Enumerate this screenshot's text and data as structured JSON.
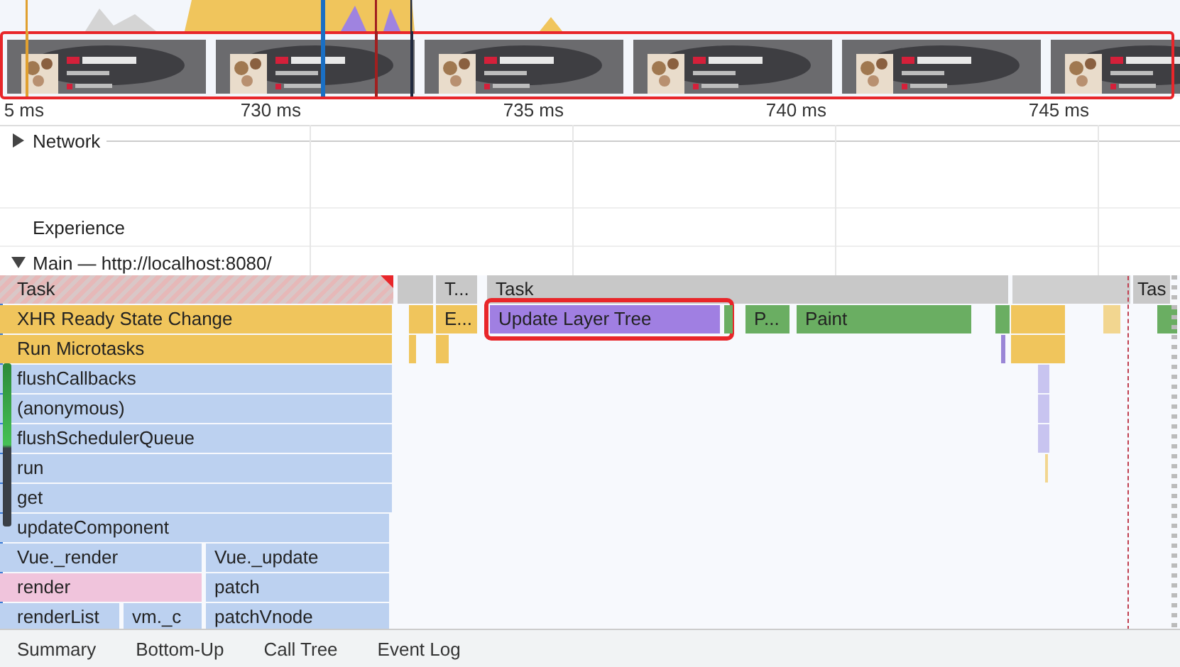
{
  "filmstrip": {
    "highlighted": true
  },
  "ruler": {
    "ticks": [
      "5 ms",
      "730 ms",
      "735 ms",
      "740 ms",
      "745 ms"
    ]
  },
  "tracks": [
    {
      "label": "Network",
      "expanded": false
    },
    {
      "label": "Experience"
    },
    {
      "label": "Main — http://localhost:8080/",
      "expanded": true
    }
  ],
  "flame_chart": {
    "rows": [
      [
        {
          "label": "Task",
          "color": "#e6b8b8",
          "long_task": true
        },
        {
          "label": "T...",
          "color": "#c8c8c8",
          "long_task": false
        },
        {
          "label": "Task",
          "color": "#c8c8c8",
          "long_task": false
        },
        {
          "label": "Tas",
          "color": "#c8c8c8",
          "long_task": false
        }
      ],
      [
        {
          "label": "XHR Ready State Change",
          "color": "#f0c55c",
          "highlighted": false
        },
        {
          "label": "E...",
          "color": "#f0c55c",
          "highlighted": false
        },
        {
          "label": "Update Layer Tree",
          "color": "#a07fe2",
          "highlighted": true
        },
        {
          "label": "P...",
          "color": "#6aae62",
          "highlighted": false
        },
        {
          "label": "Paint",
          "color": "#6aae62",
          "highlighted": false
        }
      ],
      [
        {
          "label": "Run Microtasks",
          "color": "#f0c55c"
        }
      ],
      [
        {
          "label": "flushCallbacks",
          "color": "#bcd1f0"
        }
      ],
      [
        {
          "label": "(anonymous)",
          "color": "#bcd1f0"
        }
      ],
      [
        {
          "label": "flushSchedulerQueue",
          "color": "#bcd1f0"
        }
      ],
      [
        {
          "label": "run",
          "color": "#bcd1f0"
        }
      ],
      [
        {
          "label": "get",
          "color": "#bcd1f0"
        }
      ],
      [
        {
          "label": "updateComponent",
          "color": "#bcd1f0"
        }
      ],
      [
        {
          "label": "Vue._render",
          "color": "#bcd1f0"
        },
        {
          "label": "Vue._update",
          "color": "#bcd1f0"
        }
      ],
      [
        {
          "label": "render",
          "color": "#f0c4dc"
        },
        {
          "label": "patch",
          "color": "#bcd1f0"
        }
      ],
      [
        {
          "label": "renderList",
          "color": "#bcd1f0"
        },
        {
          "label": "vm._c",
          "color": "#bcd1f0"
        },
        {
          "label": "patchVnode",
          "color": "#bcd1f0"
        }
      ]
    ]
  },
  "bottom_tabs": [
    {
      "label": "Summary",
      "selected": false
    },
    {
      "label": "Bottom-Up",
      "selected": false
    },
    {
      "label": "Call Tree",
      "selected": false
    },
    {
      "label": "Event Log",
      "selected": false
    }
  ]
}
